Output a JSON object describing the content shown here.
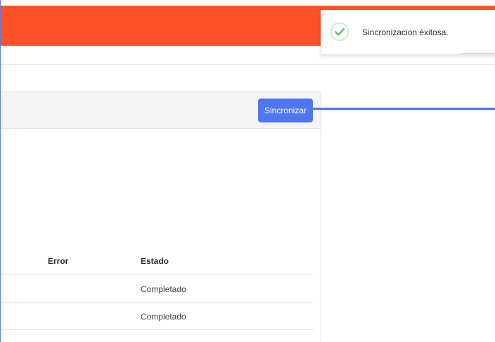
{
  "colors": {
    "top_bar": "#fe5129",
    "accent_blue": "#4f76f0",
    "success_green": "#6cc070"
  },
  "toast": {
    "icon": "check-circle-icon",
    "message": "Sincronizacion éxitosa."
  },
  "card": {
    "sync_label": "Sincronizar"
  },
  "table": {
    "columns": [
      "Error",
      "Estado"
    ],
    "rows": [
      {
        "error": "",
        "estado": "Completado"
      },
      {
        "error": "",
        "estado": "Completado"
      }
    ]
  }
}
